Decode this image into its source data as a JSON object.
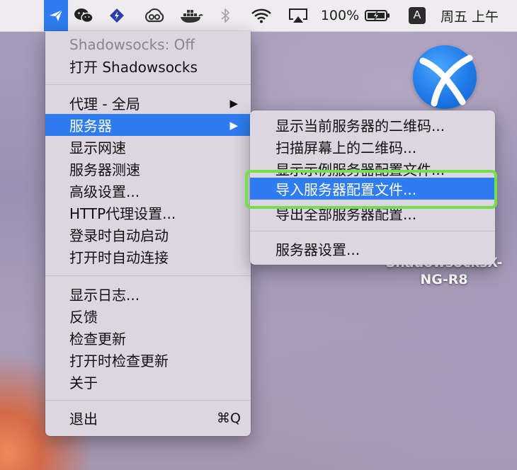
{
  "menubar": {
    "battery_percent": "100%",
    "input_method": "A",
    "clock": "周五 上午",
    "icons": [
      "paper-plane-icon",
      "wechat-icon",
      "lightning-bolt-icon",
      "creative-cloud-icon",
      "docker-icon",
      "bluetooth-icon",
      "wifi-icon",
      "airplay-icon",
      "battery-charging-icon"
    ]
  },
  "menu": {
    "status": "Shadowsocks: Off",
    "toggle": "打开 Shadowsocks",
    "proxy_mode": "代理 - 全局",
    "servers": "服务器",
    "show_speed": "显示网速",
    "server_speed_test": "服务器测速",
    "advanced_settings": "高级设置...",
    "http_proxy_settings": "HTTP代理设置...",
    "launch_at_login": "登录时自动启动",
    "connect_on_open": "打开时自动连接",
    "show_log": "显示日志...",
    "feedback": "反馈",
    "check_updates": "检查更新",
    "check_updates_on_open": "打开时检查更新",
    "about": "关于",
    "quit": "退出",
    "quit_shortcut": "⌘Q"
  },
  "submenu": {
    "items": [
      "显示当前服务器的二维码...",
      "扫描屏幕上的二维码...",
      "显示示例服务器配置文件...",
      "导入服务器配置文件...",
      "导出全部服务器配置...",
      "服务器设置..."
    ],
    "selected": "导入服务器配置文件..."
  },
  "desktop": {
    "icon_label_line1": "ShadowsocksX-",
    "icon_label_line2": "NG-R8"
  },
  "colors": {
    "selection": "#2e7cf0",
    "callout": "#71e04a",
    "menu_bg": "#dbd6e0"
  }
}
